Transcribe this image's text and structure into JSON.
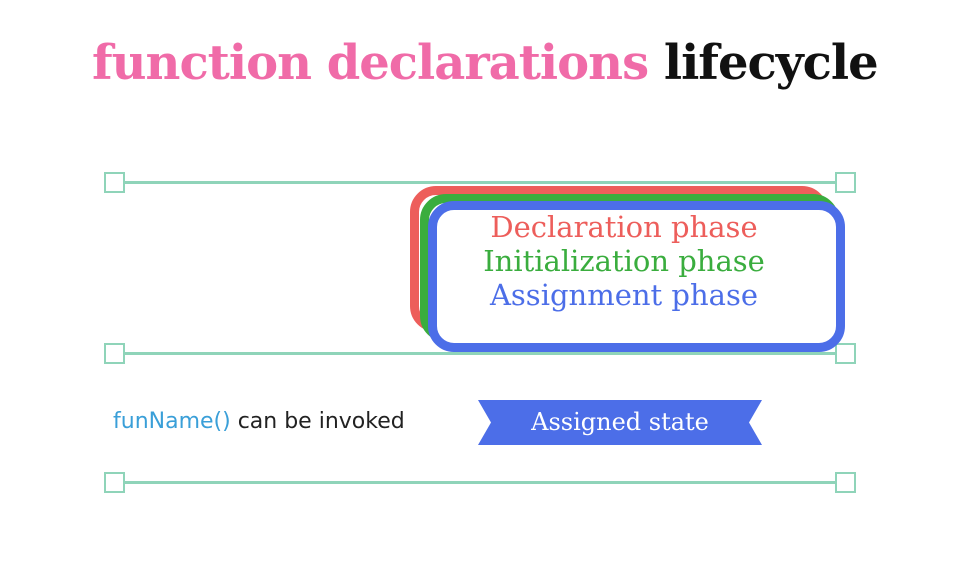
{
  "title": {
    "part1": "function declarations",
    "part2": "lifecycle"
  },
  "phases": {
    "declaration": "Declaration phase",
    "initialization": "Initialization phase",
    "assignment": "Assignment phase"
  },
  "invoke": {
    "code": "funName()",
    "text": " can be invoked"
  },
  "state_label": "Assigned state",
  "colors": {
    "title_pink": "#f06ba8",
    "title_dark": "#111111",
    "track": "#8fd4b9",
    "declaration": "#ed5e5b",
    "initialization": "#3aad3e",
    "assignment": "#4c6ee8",
    "code": "#3a9fd8",
    "banner": "#4c6ee8"
  }
}
